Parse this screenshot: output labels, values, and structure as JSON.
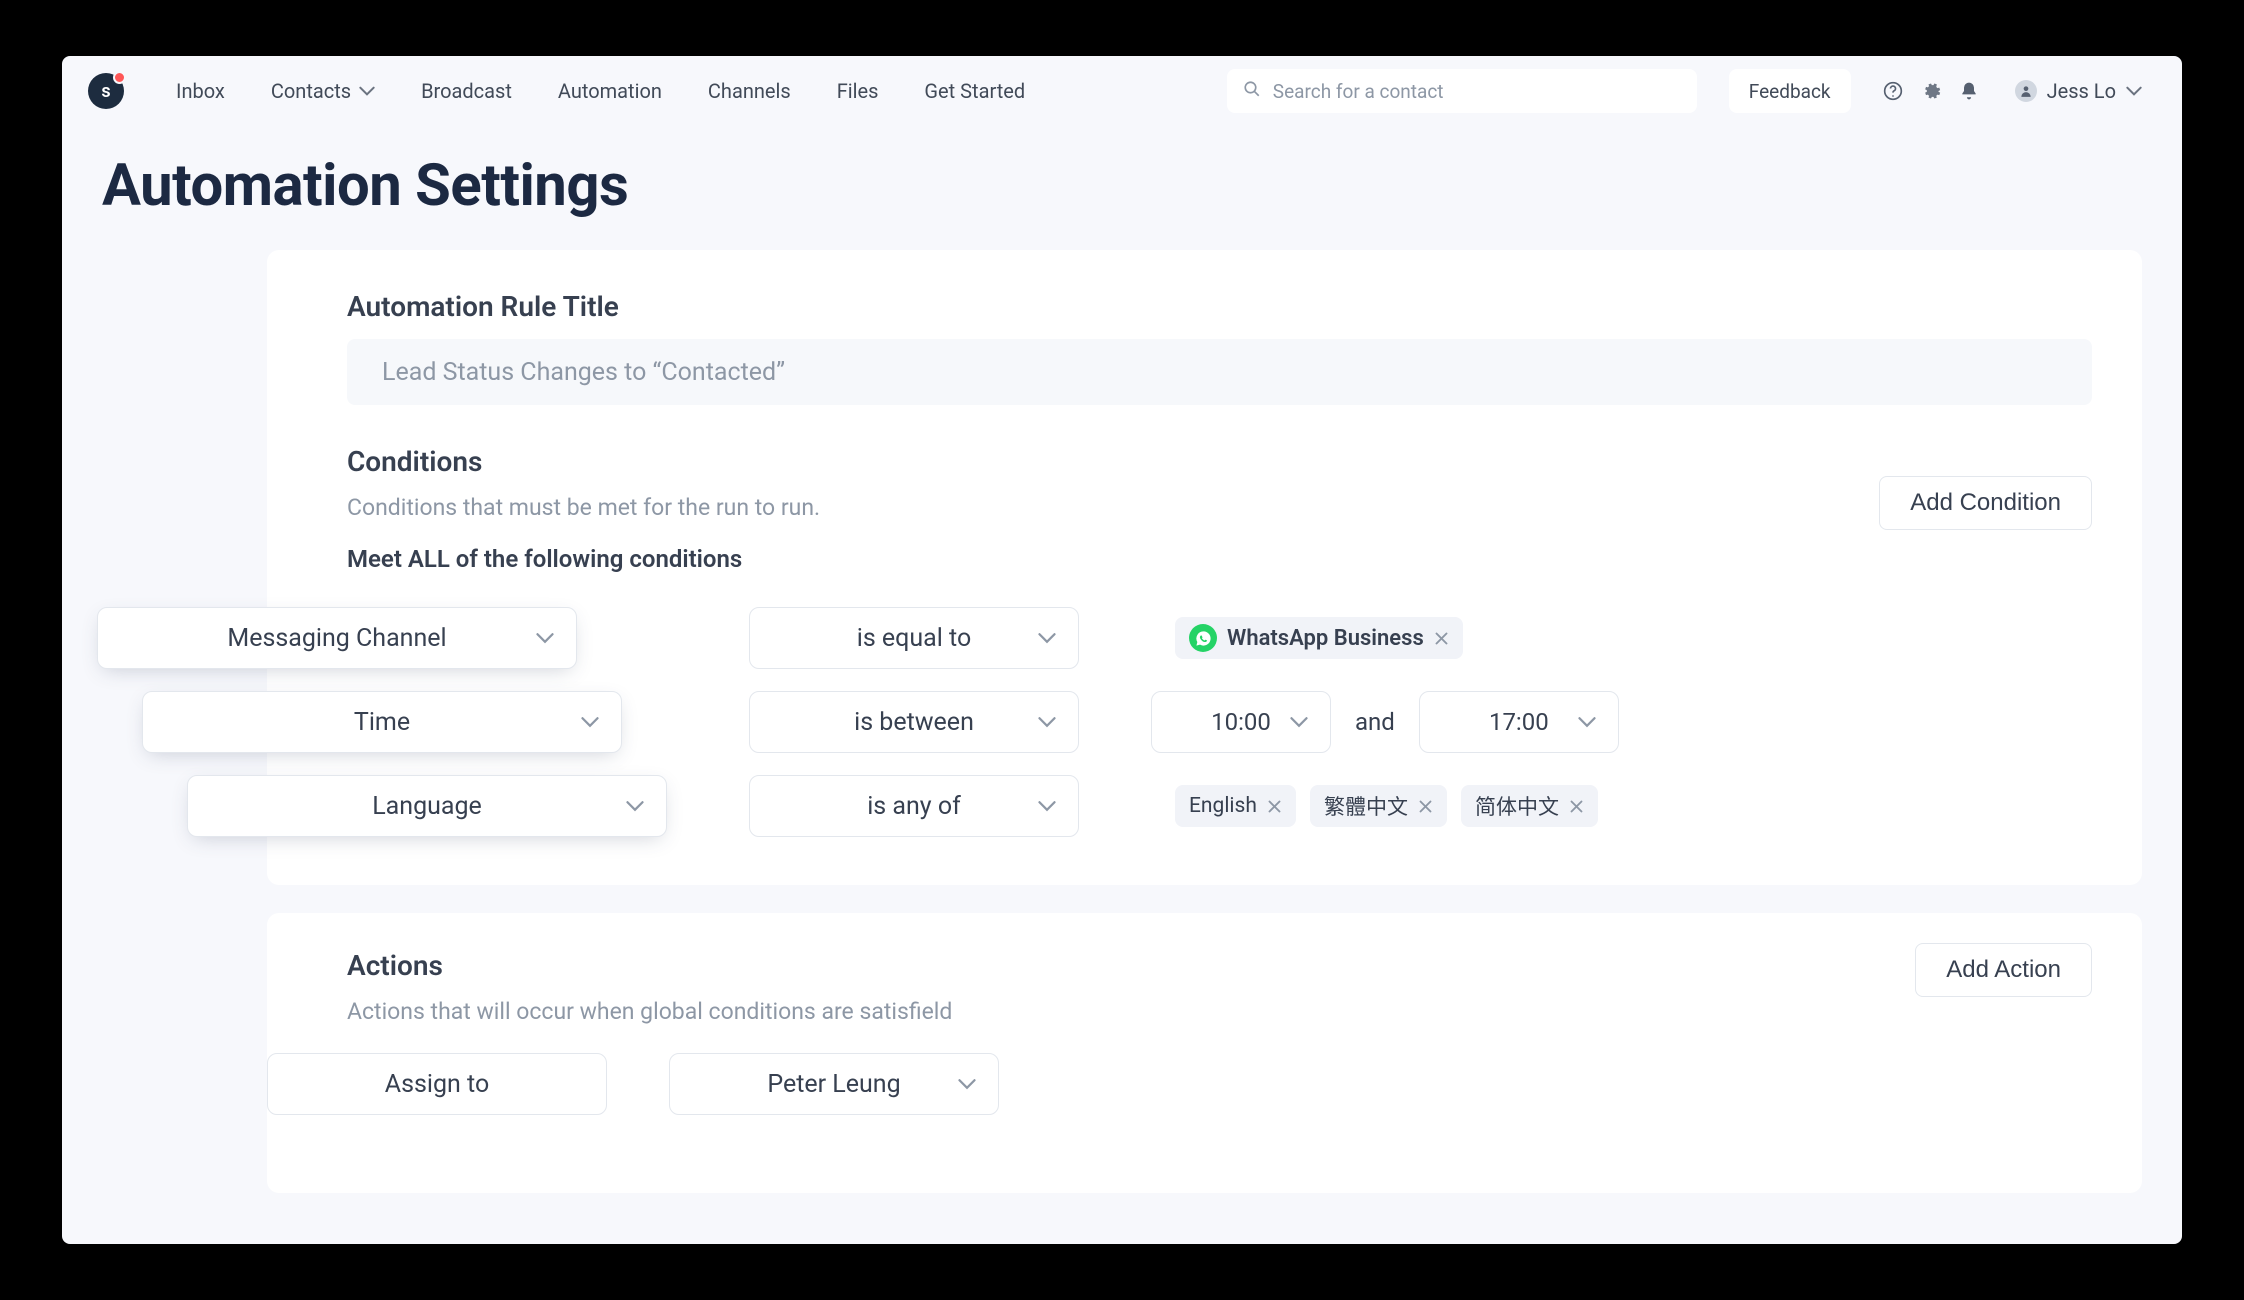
{
  "logo": "s",
  "nav": {
    "inbox": "Inbox",
    "contacts": "Contacts",
    "broadcast": "Broadcast",
    "automation": "Automation",
    "channels": "Channels",
    "files": "Files",
    "get_started": "Get Started"
  },
  "search": {
    "placeholder": "Search for a contact"
  },
  "feedback": "Feedback",
  "user": {
    "name": "Jess Lo"
  },
  "page_title": "Automation Settings",
  "rule": {
    "title_label": "Automation Rule Title",
    "title_value": "Lead Status Changes to “Contacted”"
  },
  "conditions": {
    "heading": "Conditions",
    "sub": "Conditions that must be met for the run to run.",
    "match_label": "Meet ALL of the following conditions",
    "add_btn": "Add Condition",
    "rows": [
      {
        "field": "Messaging Channel",
        "op": "is equal to",
        "value_chips": [
          {
            "label": "WhatsApp Business",
            "icon": "whatsapp"
          }
        ]
      },
      {
        "field": "Time",
        "op": "is between",
        "time_from": "10:00",
        "joiner": "and",
        "time_to": "17:00"
      },
      {
        "field": "Language",
        "op": "is any of",
        "value_chips": [
          {
            "label": "English"
          },
          {
            "label": "繁體中文"
          },
          {
            "label": "简体中文"
          }
        ]
      }
    ]
  },
  "actions": {
    "heading": "Actions",
    "sub": "Actions that will occur when global conditions are satisfield",
    "add_btn": "Add Action",
    "rows": [
      {
        "action": "Assign to",
        "target": "Peter Leung"
      }
    ]
  }
}
